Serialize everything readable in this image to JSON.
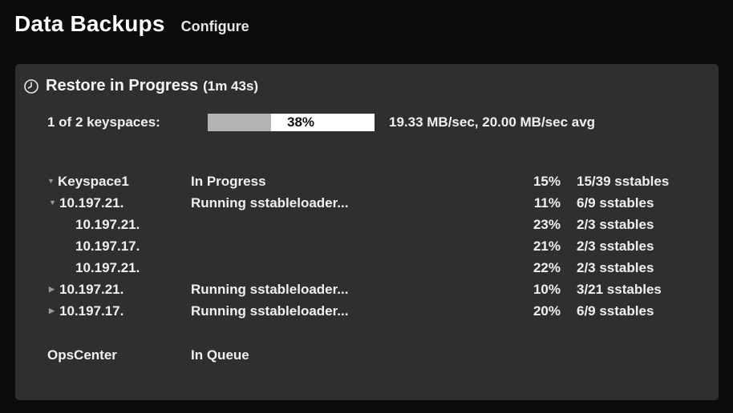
{
  "header": {
    "title": "Data Backups",
    "configure_label": "Configure"
  },
  "restore": {
    "title": "Restore in Progress",
    "elapsed": "(1m 43s)",
    "progress_label": "1 of 2 keyspaces:",
    "progress_percent": 38,
    "progress_text": "38%",
    "rate": "19.33 MB/sec, 20.00 MB/sec avg"
  },
  "rows": [
    {
      "name": "Keyspace1",
      "status": "In Progress",
      "pct": "15%",
      "count": "15/39 sstables"
    },
    {
      "name": "10.197.21.",
      "status": "Running sstableloader...",
      "pct": "11%",
      "count": "6/9 sstables"
    },
    {
      "name": "10.197.21.",
      "status": "",
      "pct": "23%",
      "count": "2/3 sstables"
    },
    {
      "name": "10.197.17.",
      "status": "",
      "pct": "21%",
      "count": "2/3 sstables"
    },
    {
      "name": "10.197.21.",
      "status": "",
      "pct": "22%",
      "count": "2/3 sstables"
    },
    {
      "name": "10.197.21.",
      "status": "Running sstableloader...",
      "pct": "10%",
      "count": "3/21 sstables"
    },
    {
      "name": "10.197.17.",
      "status": "Running sstableloader...",
      "pct": "20%",
      "count": "6/9 sstables"
    },
    {
      "name": "OpsCenter",
      "status": "In Queue",
      "pct": "",
      "count": ""
    }
  ],
  "icons": {
    "clock": "clock-icon",
    "expanded": "triangle-down-icon",
    "collapsed": "triangle-right-icon"
  },
  "colors": {
    "panel": "#2f2f2f",
    "background": "#0b0b0b",
    "progress_fill": "#b4b4b4",
    "progress_track": "#ffffff"
  }
}
